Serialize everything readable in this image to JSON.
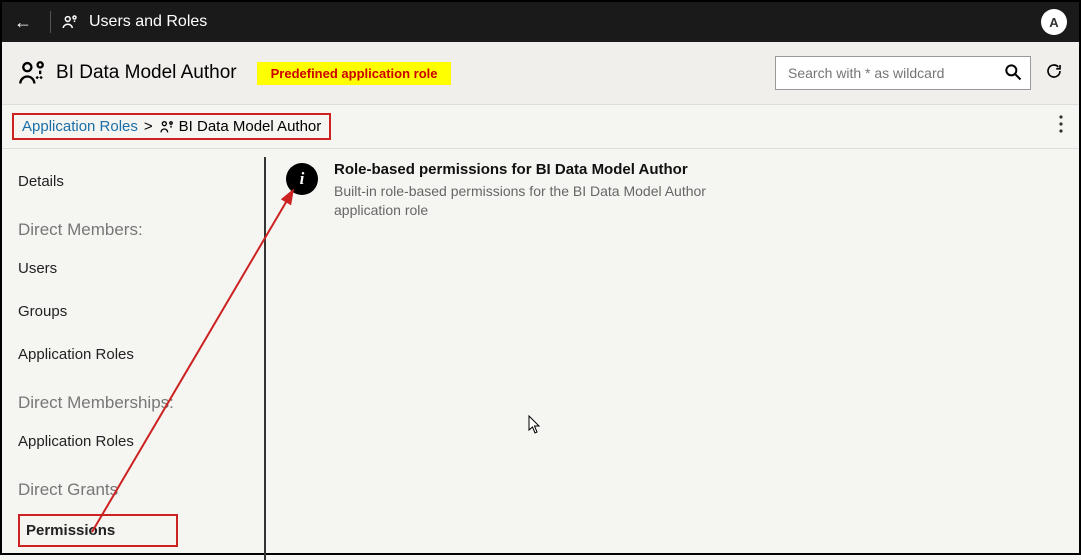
{
  "topbar": {
    "title": "Users and Roles",
    "avatar": "A"
  },
  "header": {
    "title": "BI Data Model Author",
    "badge": "Predefined application role"
  },
  "search": {
    "placeholder": "Search with * as wildcard",
    "value": ""
  },
  "breadcrumb": {
    "root": "Application Roles",
    "current": "BI Data Model Author"
  },
  "sidebar": {
    "details": "Details",
    "members_heading": "Direct Members:",
    "users": "Users",
    "groups": "Groups",
    "app_roles": "Application Roles",
    "memberships_heading": "Direct Memberships:",
    "app_roles2": "Application Roles",
    "grants_heading": "Direct Grants",
    "permissions": "Permissions"
  },
  "content": {
    "info_glyph": "i",
    "perm_title": "Role-based permissions for BI Data Model Author",
    "perm_desc": "Built-in role-based permissions for the BI Data Model Author application role"
  }
}
